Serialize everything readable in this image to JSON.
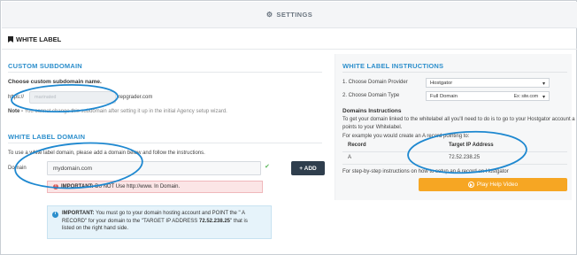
{
  "header": {
    "title": "SETTINGS",
    "icon": "gear-icon"
  },
  "page": {
    "heading": "WHITE LABEL",
    "heading_icon": "bookmark-icon"
  },
  "custom_subdomain": {
    "title": "CUSTOM SUBDOMAIN",
    "label": "Choose custom subdomain name.",
    "prefix": "https://",
    "value": "marinated",
    "suffix": ".repgrader.com",
    "note_label": "Note -",
    "note_text": "You cannot change this subdomain after setting it up in the initial Agency setup wizard."
  },
  "white_label_domain": {
    "title": "WHITE LABEL DOMAIN",
    "intro": "To use a white label domain, please add a domain below and follow the instructions.",
    "field_label": "Domain",
    "field_value": "mydomain.com",
    "error_prefix": "IMPORTANT:",
    "error_text": "Do NOT Use http://www. In Domain.",
    "add_label": "+ ADD",
    "info_prefix": "IMPORTANT:",
    "info_line1": "You must go to your domain hosting account and POINT the \" A",
    "info_line2_pre": "RECORD\" for your domain to the \"TARGET IP ADDRESS",
    "info_ip": "72.52.238.25",
    "info_line2_post": "\" that is",
    "info_line3": "listed on the right hand side."
  },
  "instructions": {
    "title": "WHITE LABEL INSTRUCTIONS",
    "step1_label": "1. Choose Domain Provider",
    "step1_value": "Hostgator",
    "step2_label": "2. Choose Domain Type",
    "step2_value": "Full Domain",
    "step2_example": "Ex: site.com",
    "domains_title": "Domains Instructions",
    "domains_line1": "To get your domain linked to the whitelabel all you'll need to do is to go to your Hostgator account a",
    "domains_line2": "points to your Whitelabel.",
    "domains_line3": "For example you would create an A record pointing to:",
    "table_headers": [
      "Record",
      "Target IP Address"
    ],
    "table_rows": [
      [
        "A",
        "72.52.238.25"
      ]
    ],
    "steps_text": "For step-by-step instructions on how to setup an A record on Hostgator",
    "play_label": "Play Help Video"
  },
  "colors": {
    "accent": "#2d8fcc",
    "annotation": "#1e88d0",
    "play": "#f6a623"
  }
}
